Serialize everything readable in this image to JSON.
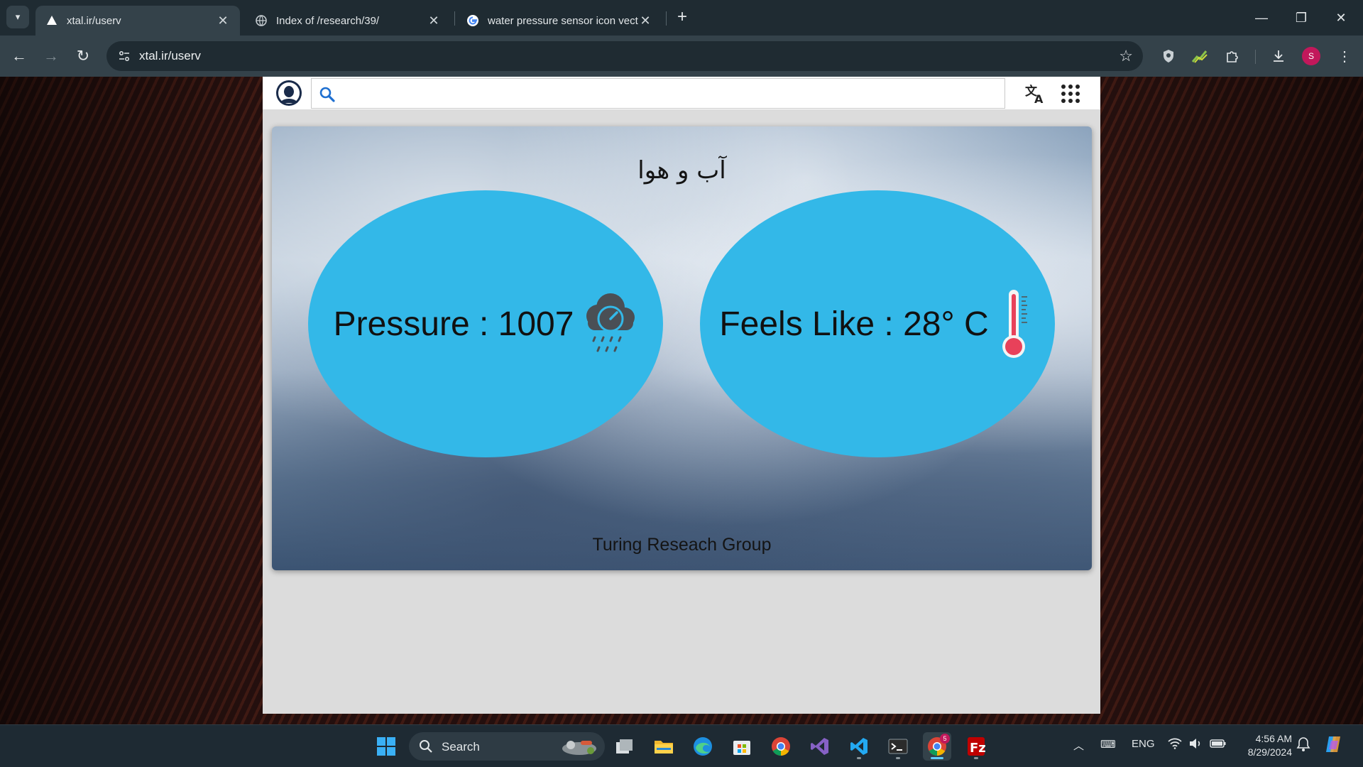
{
  "browser": {
    "tabs": [
      {
        "title": "xtal.ir/userv",
        "active": true
      },
      {
        "title": "Index of /research/39/",
        "active": false
      },
      {
        "title": "water pressure sensor icon vect",
        "active": false
      }
    ],
    "url": "xtal.ir/userv",
    "profile_initial": "S",
    "download_badge": "5"
  },
  "site": {
    "search_placeholder": "",
    "weather": {
      "title": "آب و هوا",
      "pressure_text": "Pressure : 1007",
      "feels_like_text": "Feels Like : 28° C",
      "footer": "Turing Reseach Group"
    }
  },
  "taskbar": {
    "search_label": "Search",
    "language": "ENG",
    "time": "4:56 AM",
    "date": "8/29/2024",
    "chrome_badge": "5"
  },
  "colors": {
    "bubble": "#33b8e8",
    "thermometer": "#e8415a"
  }
}
